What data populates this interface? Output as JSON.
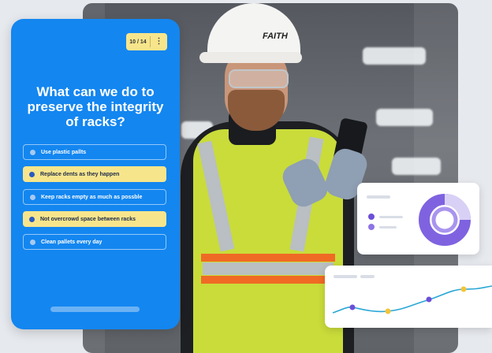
{
  "quiz": {
    "counter": "10 / 14",
    "menu_glyph": "⋮",
    "question": "What can we do to preserve the integrity of racks?",
    "options": [
      {
        "label": "Use plastic pallts",
        "selected": false
      },
      {
        "label": "Replace  dents as they happen",
        "selected": true
      },
      {
        "label": "Keep racks empty as much as possble",
        "selected": false
      },
      {
        "label": "Not overcrowd space between racks",
        "selected": true
      },
      {
        "label": "Clean pallets every day",
        "selected": false
      }
    ]
  },
  "photo": {
    "helmet_logo": "FAITH"
  },
  "colors": {
    "quiz_bg": "#1386f0",
    "selected_option": "#f7e58c",
    "accent_purple": "#6c4fd8",
    "accent_yellow": "#f2c43a",
    "line_teal": "#2aa7d6"
  }
}
